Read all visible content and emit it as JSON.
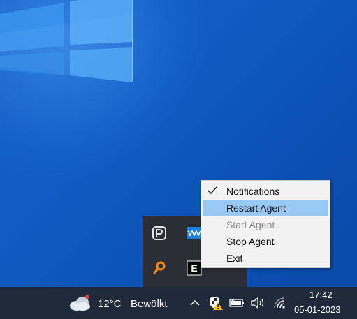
{
  "context_menu": {
    "items": [
      {
        "label": "Notifications",
        "checked": true,
        "state": "normal"
      },
      {
        "label": "Restart Agent",
        "checked": false,
        "state": "highlighted"
      },
      {
        "label": "Start Agent",
        "checked": false,
        "state": "disabled"
      },
      {
        "label": "Stop Agent",
        "checked": false,
        "state": "normal"
      },
      {
        "label": "Exit",
        "checked": false,
        "state": "normal"
      }
    ]
  },
  "tray_overflow": {
    "icons": [
      "p-app-icon",
      "audio-wave-icon",
      "search-orange-icon",
      "e-app-icon"
    ]
  },
  "taskbar": {
    "weather": {
      "temperature": "12°C",
      "condition": "Bewölkt",
      "icon": "cloudy-icon"
    },
    "clock": {
      "time": "17:42",
      "date": "05-01-2023"
    }
  },
  "colors": {
    "desktop": "#0f5cc4",
    "taskbar": "#202a3a",
    "menu_bg": "#f2f2f2",
    "menu_highlight": "#99c9f5",
    "menu_disabled_text": "#8e8e8e"
  }
}
